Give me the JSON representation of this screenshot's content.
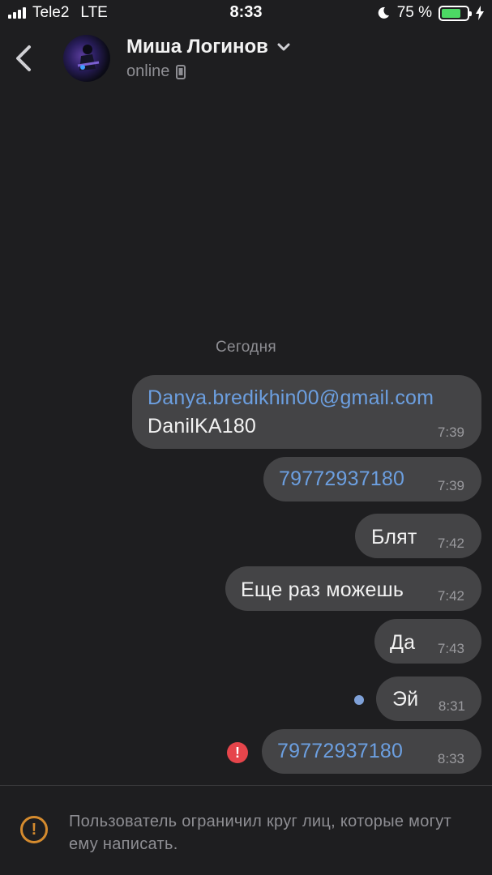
{
  "status_bar": {
    "carrier": "Tele2",
    "network": "LTE",
    "time": "8:33",
    "battery_percent": "75 %",
    "battery_level": 0.75
  },
  "header": {
    "contact_name": "Миша Логинов",
    "status": "online"
  },
  "date_separator": "Сегодня",
  "messages": [
    {
      "link": "Danya.bredikhin00@gmail.com",
      "text": "DanilKA180",
      "time": "7:39"
    },
    {
      "link": "79772937180",
      "time": "7:39"
    },
    {
      "text": "Блят",
      "time": "7:42"
    },
    {
      "text": "Еще раз можешь",
      "time": "7:42"
    },
    {
      "text": "Да",
      "time": "7:43"
    },
    {
      "text": "Эй",
      "time": "8:31",
      "state": "unread"
    },
    {
      "link": "79772937180",
      "time": "8:33",
      "state": "error"
    }
  ],
  "footer": {
    "notice": "Пользователь ограничил круг лиц, которые могут ему написать."
  },
  "colors": {
    "background": "#1e1e20",
    "bubble": "#444446",
    "link": "#6c9fe0",
    "battery": "#4cd964",
    "error": "#e6454b",
    "warning": "#d58b2e"
  }
}
